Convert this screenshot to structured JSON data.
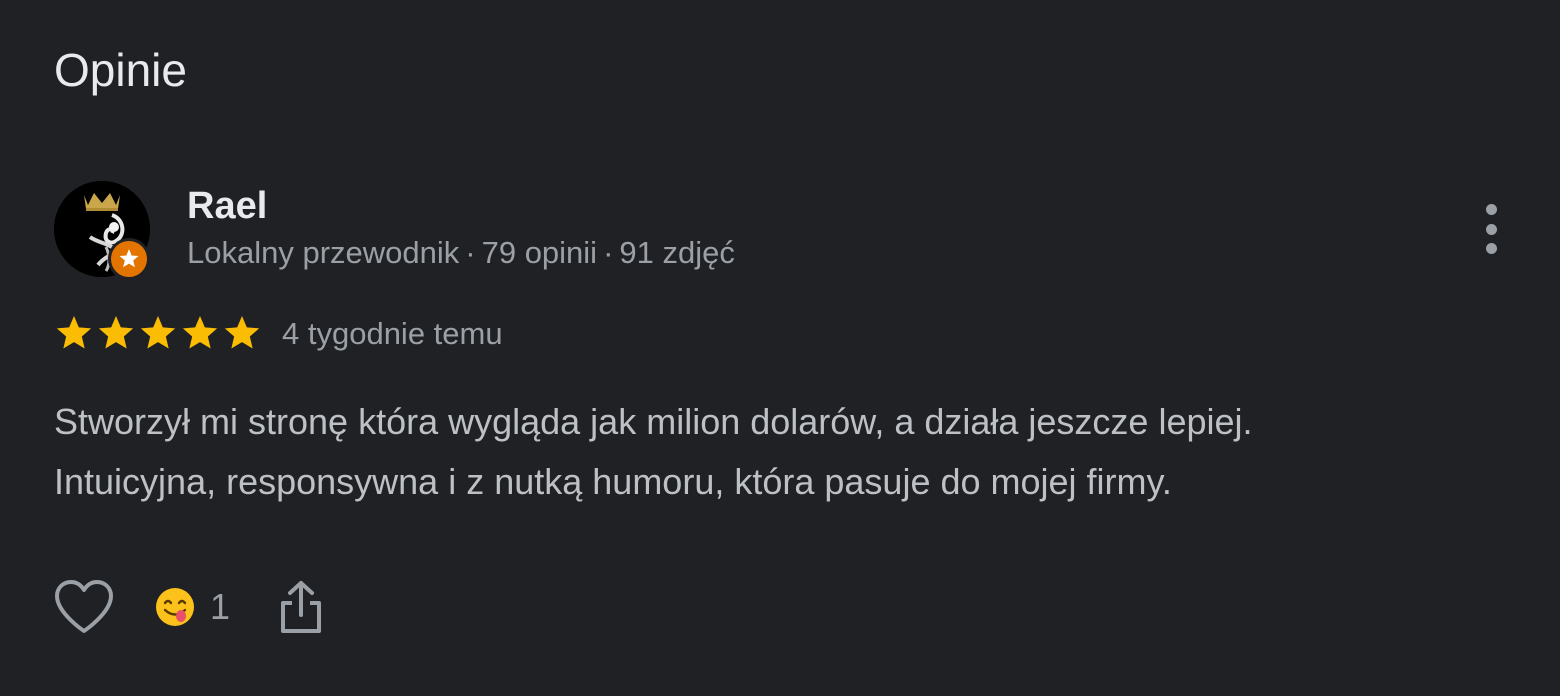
{
  "section": {
    "title": "Opinie"
  },
  "review": {
    "author": {
      "name": "Rael",
      "meta": [
        "Lokalny przewodnik",
        "79 opinii",
        "91 zdjęć"
      ],
      "meta_separator": "·",
      "avatar_icon": "crowned-figure-avatar",
      "badge_icon": "local-guide-star-badge",
      "badge_color": "#e37400"
    },
    "rating": {
      "value": 5,
      "max": 5,
      "star_color": "#fbbc04"
    },
    "date": "4 tygodnie temu",
    "text_lines": [
      "Stworzył mi stronę która wygląda jak milion dolarów, a działa jeszcze lepiej.",
      "Intuicyjna, responsywna i z nutką humoru, która pasuje do mojej firmy."
    ],
    "more_icon": "more-vert-icon",
    "actions": {
      "like_icon": "heart-outline-icon",
      "reaction_icon": "yum-face-emoji",
      "reaction_count": "1",
      "share_icon": "share-icon"
    }
  }
}
